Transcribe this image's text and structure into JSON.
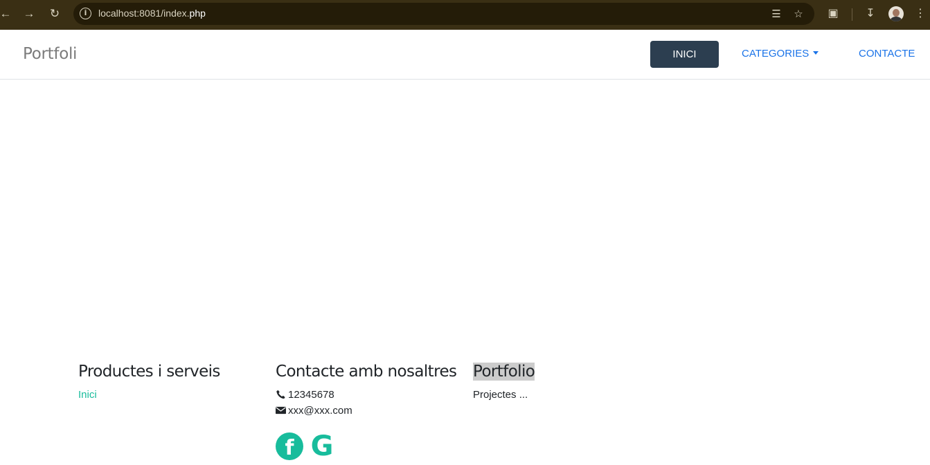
{
  "browser": {
    "url_host": "localhost:8081/index.",
    "url_path": "php",
    "icons": {
      "back": "arrow-left-icon",
      "forward": "arrow-right-icon",
      "reload": "reload-icon",
      "info": "info-icon",
      "translate": "translate-icon",
      "bookmark": "star-icon",
      "extensions": "puzzle-icon",
      "downloads": "download-icon",
      "profile": "avatar",
      "menu": "kebab-menu-icon"
    }
  },
  "nav": {
    "brand": "Portfoli",
    "items": [
      {
        "label": "INICI",
        "active": true
      },
      {
        "label": "CATEGORIES"
      },
      {
        "label": "CONTACTE"
      }
    ]
  },
  "footer": {
    "col1": {
      "title": "Productes i serveis",
      "link": "Inici"
    },
    "col2": {
      "title": "Contacte amb nosaltres",
      "phone": "12345678",
      "email": "xxx@xxx.com"
    },
    "col3": {
      "title": "Portfolio",
      "text": "Projectes ..."
    }
  },
  "colors": {
    "accent": "#18bc9c",
    "nav_active_bg": "#2c3e50",
    "link": "#1a73e8"
  }
}
